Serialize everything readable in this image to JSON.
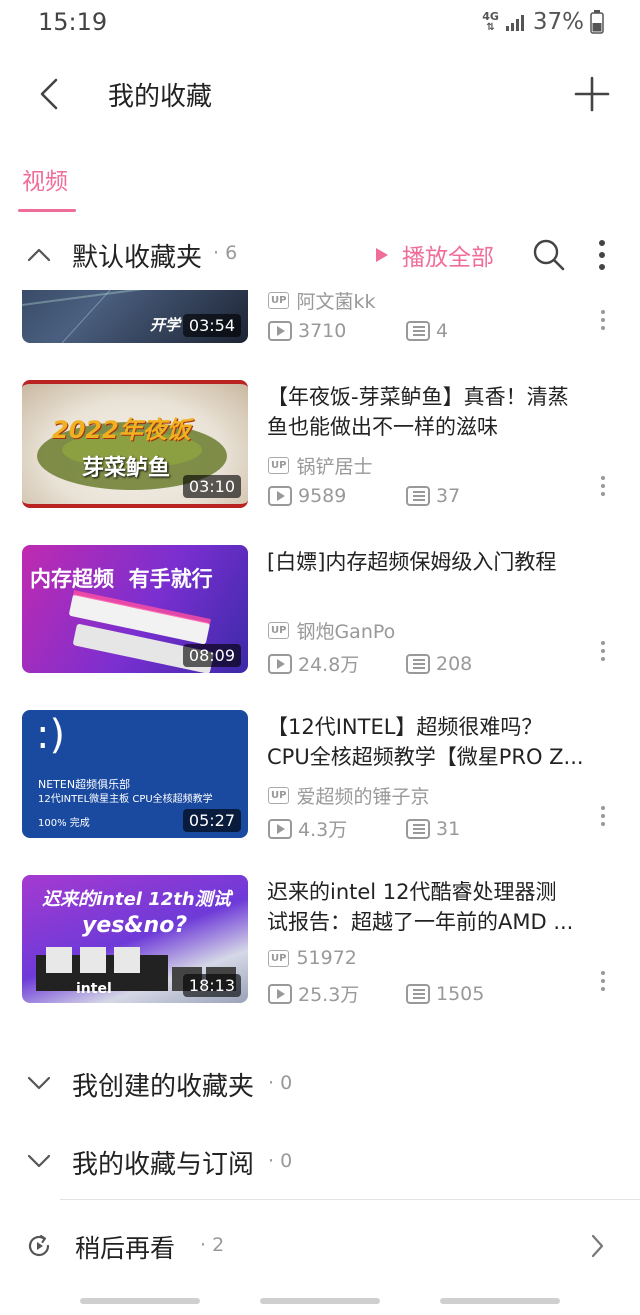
{
  "status_bar": {
    "time": "15:19",
    "network": "4G",
    "battery": "37%"
  },
  "header": {
    "title": "我的收藏"
  },
  "tabs": [
    {
      "label": "视频",
      "active": true
    }
  ],
  "default_folder": {
    "title": "默认收藏夹",
    "count": "· 6",
    "play_all_label": "播放全部"
  },
  "videos": [
    {
      "title_line1": "",
      "title_line2": "",
      "thumb_text": "开学",
      "up": "阿文菌kk",
      "views": "3710",
      "danmaku": "4",
      "duration": "03:54"
    },
    {
      "title_line1": "【年夜饭-芽菜鲈鱼】真香！清蒸",
      "title_line2": "鱼也能做出不一样的滋味",
      "thumb_text": "2022年夜饭",
      "thumb_text2": "芽菜鲈鱼",
      "up": "锅铲居士",
      "views": "9589",
      "danmaku": "37",
      "duration": "03:10"
    },
    {
      "title_line1": "[白嫖]内存超频保姆级入门教程",
      "title_line2": "",
      "thumb_text": "内存超频  有手就行",
      "up": "钢炮GanPo",
      "views": "24.8万",
      "danmaku": "208",
      "duration": "08:09"
    },
    {
      "title_line1": "【12代INTEL】超频很难吗？",
      "title_line2": "CPU全核超频教学【微星PRO Z...",
      "thumb_text": ":)",
      "thumb_text2": "NETEN超频俱乐部",
      "thumb_text3": "12代INTEL微星主板 CPU全核超频教学",
      "thumb_text4": "100% 完成",
      "up": "爱超频的锤子京",
      "views": "4.3万",
      "danmaku": "31",
      "duration": "05:27"
    },
    {
      "title_line1": "迟来的intel 12代酷睿处理器测",
      "title_line2": "试报告：超越了一年前的AMD ...",
      "thumb_text": "迟来的intel 12th测试",
      "thumb_text2": "yes&no?",
      "thumb_text3": "intel",
      "up": "51972",
      "views": "25.3万",
      "danmaku": "1505",
      "duration": "18:13"
    }
  ],
  "folders": [
    {
      "label": "我创建的收藏夹",
      "count": "0"
    },
    {
      "label": "我的收藏与订阅",
      "count": "0"
    }
  ],
  "watch_later": {
    "label": "稍后再看",
    "count": "· 2"
  },
  "colors": {
    "accent": "#f06d9a",
    "text": "#222222",
    "muted": "#999999"
  },
  "icons": {
    "back": "back-arrow-icon",
    "add": "plus-icon",
    "collapse": "chevron-up-icon",
    "play_all": "play-icon",
    "search": "search-icon",
    "more": "more-vertical-icon",
    "views": "play-count-icon",
    "danmaku": "danmaku-icon",
    "expand": "chevron-down-icon",
    "watch_later": "clock-play-icon",
    "arrow": "chevron-right-icon"
  }
}
